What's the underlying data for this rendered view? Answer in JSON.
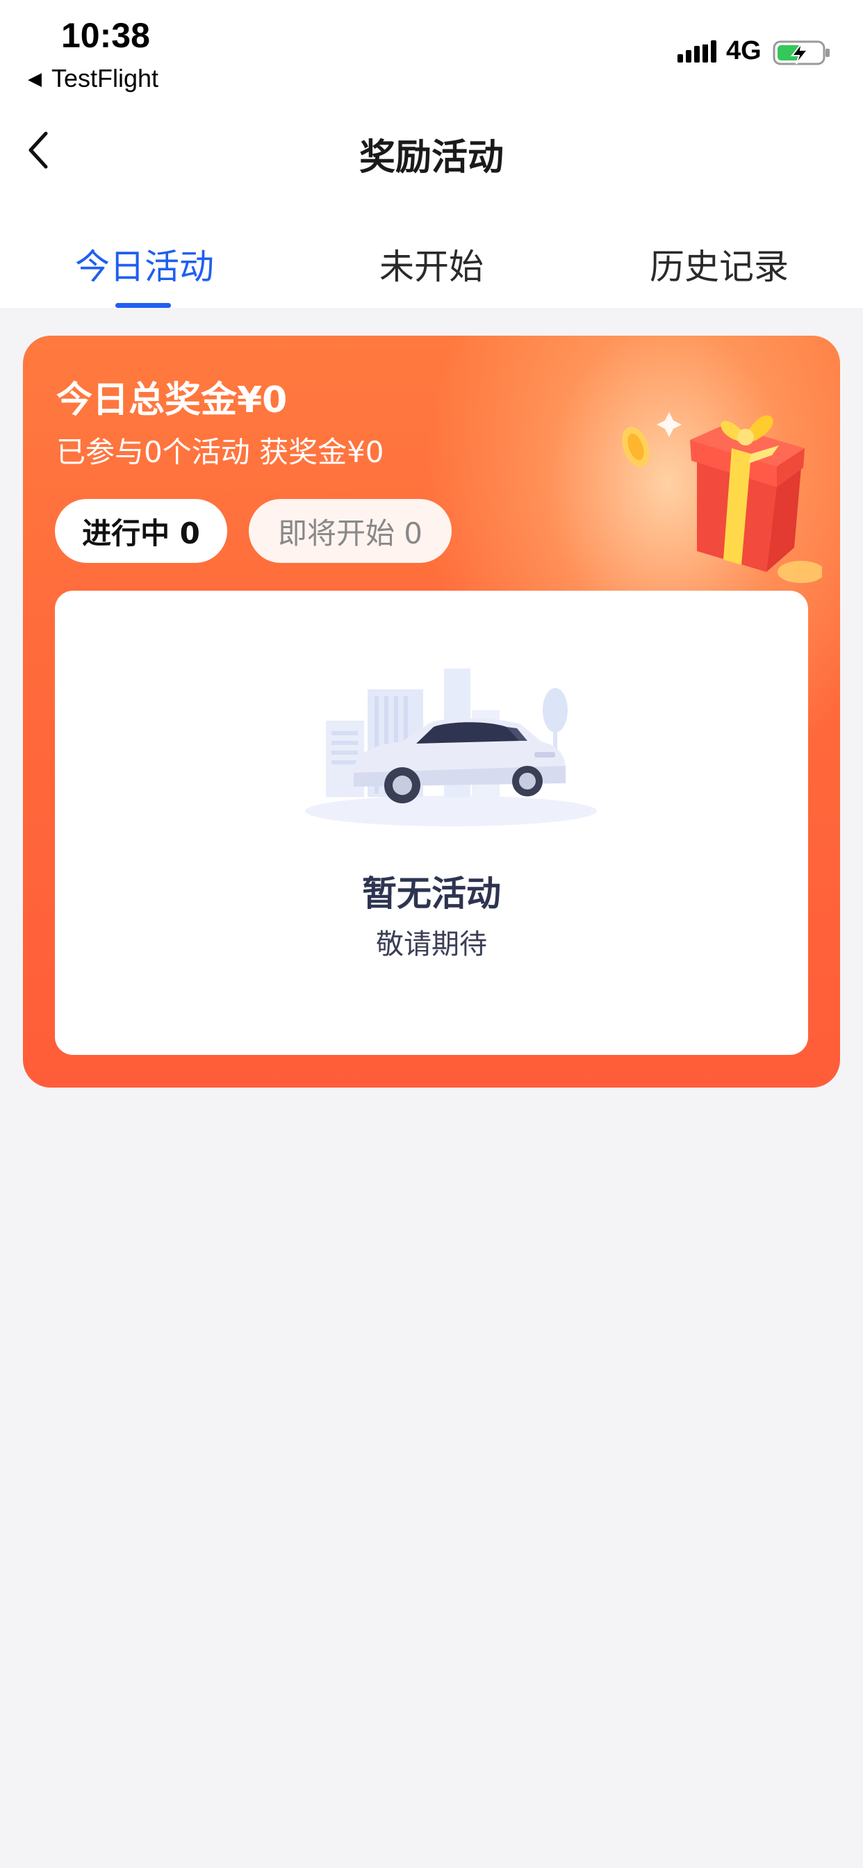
{
  "status_bar": {
    "time": "10:38",
    "back_app": "TestFlight",
    "network": "4G",
    "signal_icon": "signal-bars-icon",
    "battery_icon": "battery-charging-icon",
    "battery_color": "#34c759"
  },
  "nav": {
    "title": "奖励活动",
    "back_icon": "chevron-left-icon"
  },
  "tabs": [
    {
      "label": "今日活动",
      "active": true
    },
    {
      "label": "未开始",
      "active": false
    },
    {
      "label": "历史记录",
      "active": false
    }
  ],
  "summary": {
    "title": "今日总奖金¥0",
    "subtitle": "已参与0个活动 获奖金¥0",
    "pill_ongoing": "进行中 0",
    "pill_upcoming": "即将开始 0",
    "gift_icon": "gift-box-icon"
  },
  "empty_state": {
    "illustration": "car-city-illustration",
    "title": "暂无活动",
    "subtitle": "敬请期待"
  },
  "colors": {
    "accent": "#1f5ff0",
    "promo_orange": "#ff6a3b",
    "background": "#f4f4f7"
  }
}
